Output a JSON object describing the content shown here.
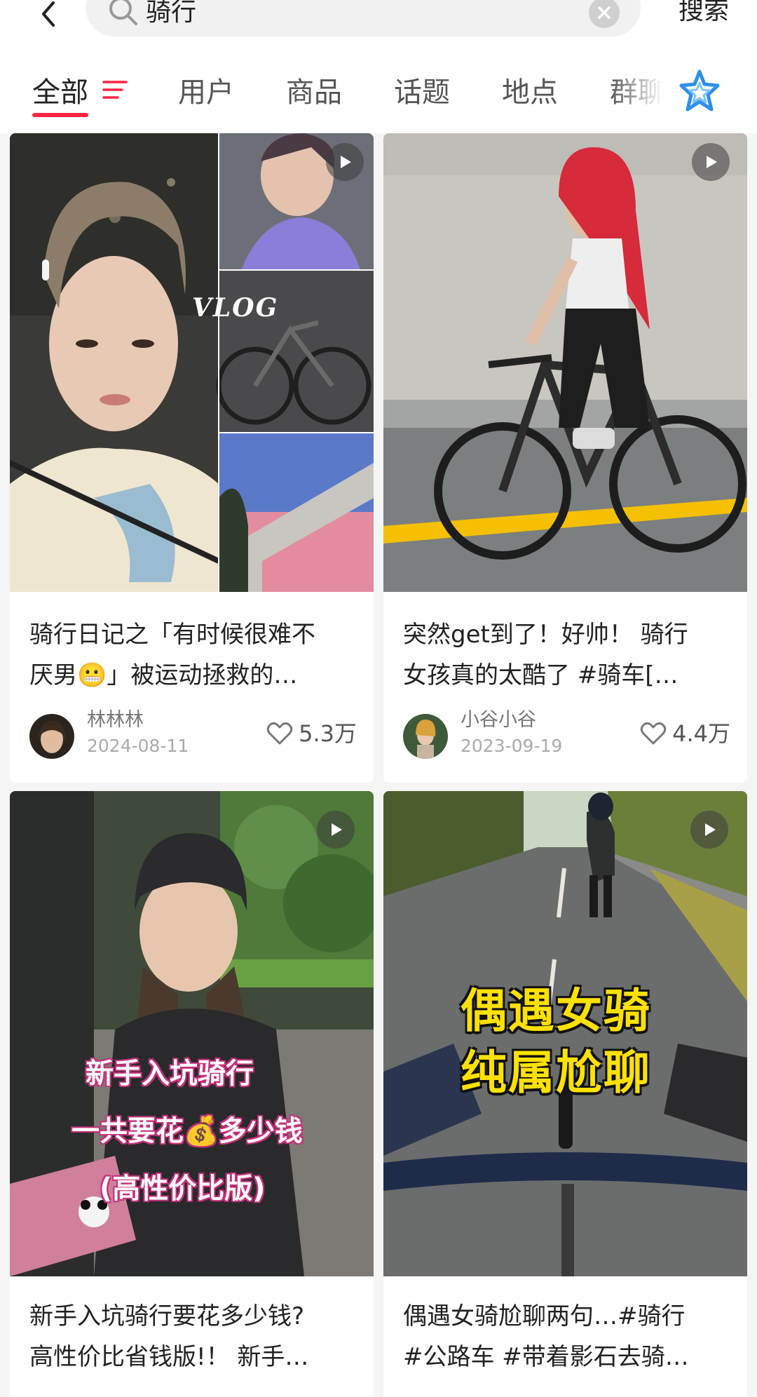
{
  "search": {
    "query": "骑行",
    "submit_label": "搜索"
  },
  "tabs": [
    {
      "label": "全部",
      "active": true
    },
    {
      "label": "用户"
    },
    {
      "label": "商品"
    },
    {
      "label": "话题"
    },
    {
      "label": "地点"
    },
    {
      "label": "群聊"
    }
  ],
  "colors": {
    "accent": "#ff2442",
    "ai_icon": "#2f8fe8"
  },
  "notes": [
    {
      "title_line1": "骑行日记之「有时候很难不",
      "title_line2": "厌男😬」被运动拯救的…",
      "author": "林林林",
      "date": "2024-08-11",
      "likes": "5.3万",
      "overlay_text": "VLOG",
      "is_video": true
    },
    {
      "title_line1": "突然get到了！好帅！ 骑行",
      "title_line2": "女孩真的太酷了 #骑车[…",
      "author": "小谷小谷",
      "date": "2023-09-19",
      "likes": "4.4万",
      "is_video": true
    },
    {
      "title_line1": "新手入坑骑行要花多少钱?",
      "title_line2": "高性价比省钱版!！ 新手…",
      "overlay_lines": [
        "新手入坑骑行",
        "一共要花💰多少钱",
        "(高性价比版)"
      ],
      "is_video": true
    },
    {
      "title_line1": "偶遇女骑尬聊两句…#骑行",
      "title_line2": "#公路车 #带着影石去骑…",
      "overlay_lines": [
        "偶遇女骑",
        "纯属尬聊"
      ],
      "is_video": true
    }
  ],
  "icons": {
    "back": "chevron-left-icon",
    "search": "magnifier-icon",
    "clear": "close-circle-icon",
    "filter": "filter-icon",
    "ai": "ai-star-icon",
    "like": "heart-outline-icon",
    "play": "play-icon"
  }
}
